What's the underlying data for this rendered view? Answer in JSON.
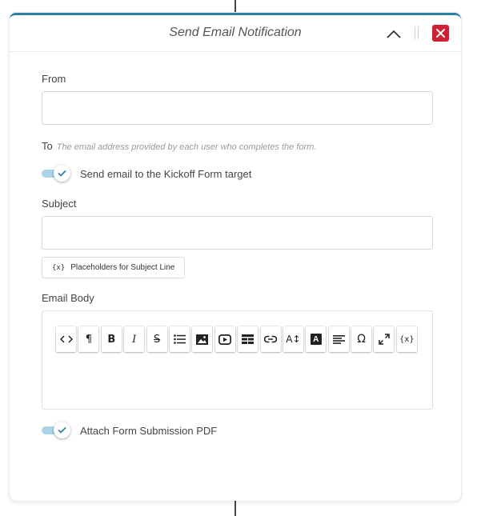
{
  "dialog": {
    "title": "Send Email Notification"
  },
  "from": {
    "label": "From",
    "value": "",
    "placeholder": ""
  },
  "to": {
    "label": "To",
    "hint": "The email address provided by each user who completes the form.",
    "toggle_label": "Send email to the Kickoff Form target",
    "toggle_on": true
  },
  "subject": {
    "label": "Subject",
    "value": "",
    "placeholder": "",
    "placeholder_button_icon": "{x}",
    "placeholder_button_label": "Placeholders for Subject Line"
  },
  "email_body": {
    "label": "Email Body",
    "value": "",
    "toolbar": [
      {
        "name": "code-view-icon"
      },
      {
        "name": "paragraph-icon",
        "glyph": "¶"
      },
      {
        "name": "bold-icon",
        "glyph": "B"
      },
      {
        "name": "italic-icon",
        "glyph": "I"
      },
      {
        "name": "strikethrough-icon",
        "glyph": "S"
      },
      {
        "name": "bulleted-list-icon"
      },
      {
        "name": "insert-image-icon"
      },
      {
        "name": "insert-video-icon"
      },
      {
        "name": "insert-table-icon"
      },
      {
        "name": "insert-link-icon"
      },
      {
        "name": "font-size-icon",
        "glyph": "A↕"
      },
      {
        "name": "text-color-icon",
        "glyph": "A"
      },
      {
        "name": "align-icon"
      },
      {
        "name": "special-characters-icon",
        "glyph": "Ω"
      },
      {
        "name": "fullscreen-icon"
      },
      {
        "name": "placeholders-icon",
        "glyph": "{x}"
      }
    ]
  },
  "attach": {
    "toggle_label": "Attach Form Submission PDF",
    "toggle_on": true
  },
  "colors": {
    "accent": "#2f7fa2",
    "close_button": "#cc2233",
    "toggle_track": "#a9d4e6",
    "check": "#2f7fa2"
  }
}
